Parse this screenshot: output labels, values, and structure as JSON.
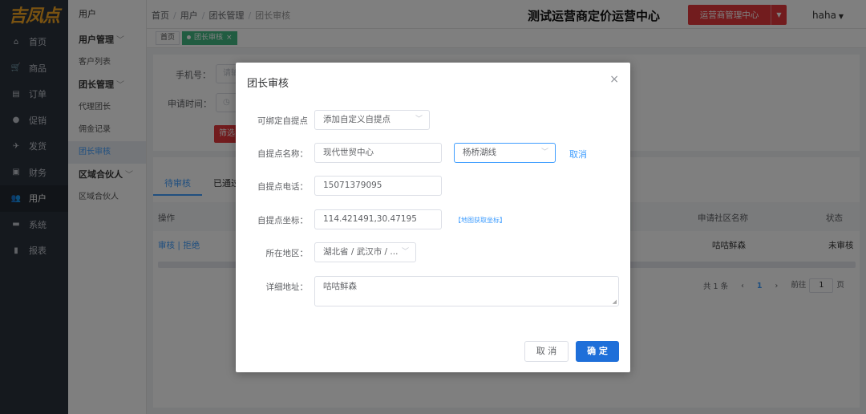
{
  "logo": "吉凤点",
  "nav": [
    {
      "label": "首页",
      "icon": "home-icon",
      "glyph": "⌂"
    },
    {
      "label": "商品",
      "icon": "cart-icon",
      "glyph": "🛒"
    },
    {
      "label": "订单",
      "icon": "order-icon",
      "glyph": "▤"
    },
    {
      "label": "促销",
      "icon": "promo-icon",
      "glyph": "●"
    },
    {
      "label": "发货",
      "icon": "delivery-icon",
      "glyph": "✈"
    },
    {
      "label": "财务",
      "icon": "finance-icon",
      "glyph": "▣"
    },
    {
      "label": "用户",
      "icon": "user-icon",
      "glyph": "👥"
    },
    {
      "label": "系统",
      "icon": "system-icon",
      "glyph": "▬"
    },
    {
      "label": "报表",
      "icon": "report-icon",
      "glyph": "▮"
    }
  ],
  "subnav": {
    "head": "用户",
    "group1": "用户管理",
    "item1": "客户列表",
    "group2": "团长管理",
    "item2": "代理团长",
    "item3": "佣金记录",
    "item4": "团长审核",
    "group3": "区域合伙人",
    "item5": "区域合伙人"
  },
  "header": {
    "crumb1": "首页",
    "crumb2": "用户",
    "crumb3": "团长管理",
    "crumb4": "团长审核",
    "title": "测试运营商定价运营中心",
    "ops_label": "运营商管理中心",
    "user": "haha"
  },
  "tags": {
    "home": "首页",
    "active": "团长审核"
  },
  "filter": {
    "phone_label": "手机号：",
    "phone_placeholder": "请输",
    "time_label": "申请时间：",
    "search_label": "筛选"
  },
  "tabs": {
    "pending": "待审核",
    "passed": "已通过"
  },
  "table": {
    "col_ops": "操作",
    "col_community": "申请社区名称",
    "col_status": "状态",
    "row_audit": "审核",
    "row_sep": "|",
    "row_reject": "拒绝",
    "row_community": "咕咕鲜森",
    "row_status": "未审核"
  },
  "pager": {
    "total": "共 1 条",
    "page": "1",
    "goto": "前往",
    "goto_value": "1",
    "page_unit": "页"
  },
  "modal": {
    "title": "团长审核",
    "f1_label": "可绑定自提点",
    "f1_value": "添加自定义自提点",
    "f2_label": "自提点名称：",
    "f2_value": "现代世贸中心",
    "f2_select": "杨桥湖线",
    "f2_cancel": "取消",
    "f3_label": "自提点电话：",
    "f3_value": "15071379095",
    "f4_label": "自提点坐标：",
    "f4_value": "114.421491,30.47195",
    "f4_link": "【地图获取坐标】",
    "f5_label": "所在地区：",
    "f5_value": "湖北省 / 武汉市 / ...",
    "f6_label": "详细地址：",
    "f6_value": "咕咕鲜森",
    "cancel": "取 消",
    "confirm": "确 定"
  }
}
